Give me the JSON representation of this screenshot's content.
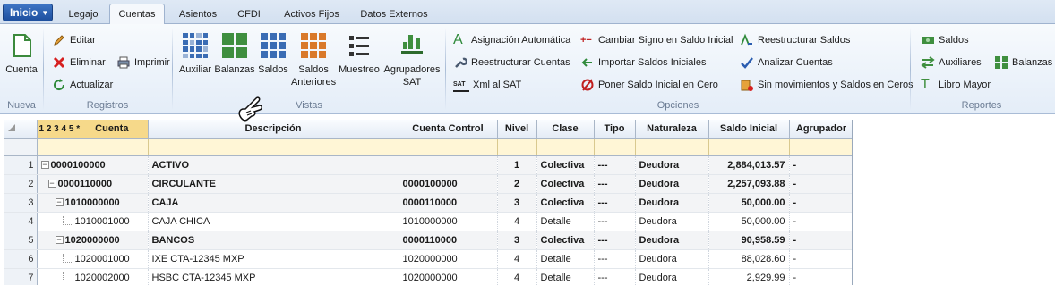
{
  "tabs": {
    "start": "Inicio",
    "items": [
      "Legajo",
      "Cuentas",
      "Asientos",
      "CFDI",
      "Activos Fijos",
      "Datos Externos"
    ]
  },
  "ribbon": {
    "nueva": {
      "cuenta": "Cuenta",
      "group": "Nueva"
    },
    "registros": {
      "editar": "Editar",
      "eliminar": "Eliminar",
      "imprimir": "Imprimir",
      "actualizar": "Actualizar",
      "group": "Registros"
    },
    "vistas": {
      "auxiliar": "Auxiliar",
      "balanzas": "Balanzas",
      "saldos": "Saldos",
      "saldos_anteriores": "Saldos\nAnteriores",
      "muestreo": "Muestreo",
      "agrupadores": "Agrupadores\nSAT",
      "group": "Vistas"
    },
    "opciones": {
      "asignacion": "Asignación Automática",
      "reestructurar_cuentas": "Reestructurar Cuentas",
      "xml": "Xml al SAT",
      "xml_badge": "SAT",
      "cambiar_signo": "Cambiar Signo en Saldo Inicial",
      "importar": "Importar Saldos Iniciales",
      "poner_cero": "Poner Saldo Inicial en Cero",
      "reestructurar_saldos": "Reestructurar Saldos",
      "analizar": "Analizar Cuentas",
      "sin_movimientos": "Sin movimientos y Saldos en Ceros",
      "group": "Opciones"
    },
    "reportes": {
      "saldos": "Saldos",
      "auxiliares": "Auxiliares",
      "balanzas": "Balanzas",
      "libro_mayor": "Libro Mayor",
      "group": "Reportes"
    }
  },
  "grid": {
    "levels": "1 2 3 4 5 *",
    "headers": [
      "Cuenta",
      "Descripción",
      "Cuenta Control",
      "Nivel",
      "Clase",
      "Tipo",
      "Naturaleza",
      "Saldo Inicial",
      "Agrupador"
    ],
    "rows": [
      {
        "n": "1",
        "cuenta": "0000100000",
        "desc": "ACTIVO",
        "control": "",
        "nivel": "1",
        "clase": "Colectiva",
        "tipo": "---",
        "nat": "Deudora",
        "saldo": "2,884,013.57",
        "agr": "-"
      },
      {
        "n": "2",
        "cuenta": "0000110000",
        "desc": "CIRCULANTE",
        "control": "0000100000",
        "nivel": "2",
        "clase": "Colectiva",
        "tipo": "---",
        "nat": "Deudora",
        "saldo": "2,257,093.88",
        "agr": "-"
      },
      {
        "n": "3",
        "cuenta": "1010000000",
        "desc": "CAJA",
        "control": "0000110000",
        "nivel": "3",
        "clase": "Colectiva",
        "tipo": "---",
        "nat": "Deudora",
        "saldo": "50,000.00",
        "agr": "-"
      },
      {
        "n": "4",
        "cuenta": "1010001000",
        "desc": "CAJA CHICA",
        "control": "1010000000",
        "nivel": "4",
        "clase": "Detalle",
        "tipo": "---",
        "nat": "Deudora",
        "saldo": "50,000.00",
        "agr": "-"
      },
      {
        "n": "5",
        "cuenta": "1020000000",
        "desc": "BANCOS",
        "control": "0000110000",
        "nivel": "3",
        "clase": "Colectiva",
        "tipo": "---",
        "nat": "Deudora",
        "saldo": "90,958.59",
        "agr": "-"
      },
      {
        "n": "6",
        "cuenta": "1020001000",
        "desc": "IXE CTA-12345 MXP",
        "control": "1020000000",
        "nivel": "4",
        "clase": "Detalle",
        "tipo": "---",
        "nat": "Deudora",
        "saldo": "88,028.60",
        "agr": "-"
      },
      {
        "n": "7",
        "cuenta": "1020002000",
        "desc": "HSBC CTA-12345 MXP",
        "control": "1020000000",
        "nivel": "4",
        "clase": "Detalle",
        "tipo": "---",
        "nat": "Deudora",
        "saldo": "2,929.99",
        "agr": "-"
      }
    ]
  },
  "colors": {
    "accent": "#2a5db0",
    "header_highlight": "#f6d98a",
    "filter_row": "#fff6d6"
  }
}
